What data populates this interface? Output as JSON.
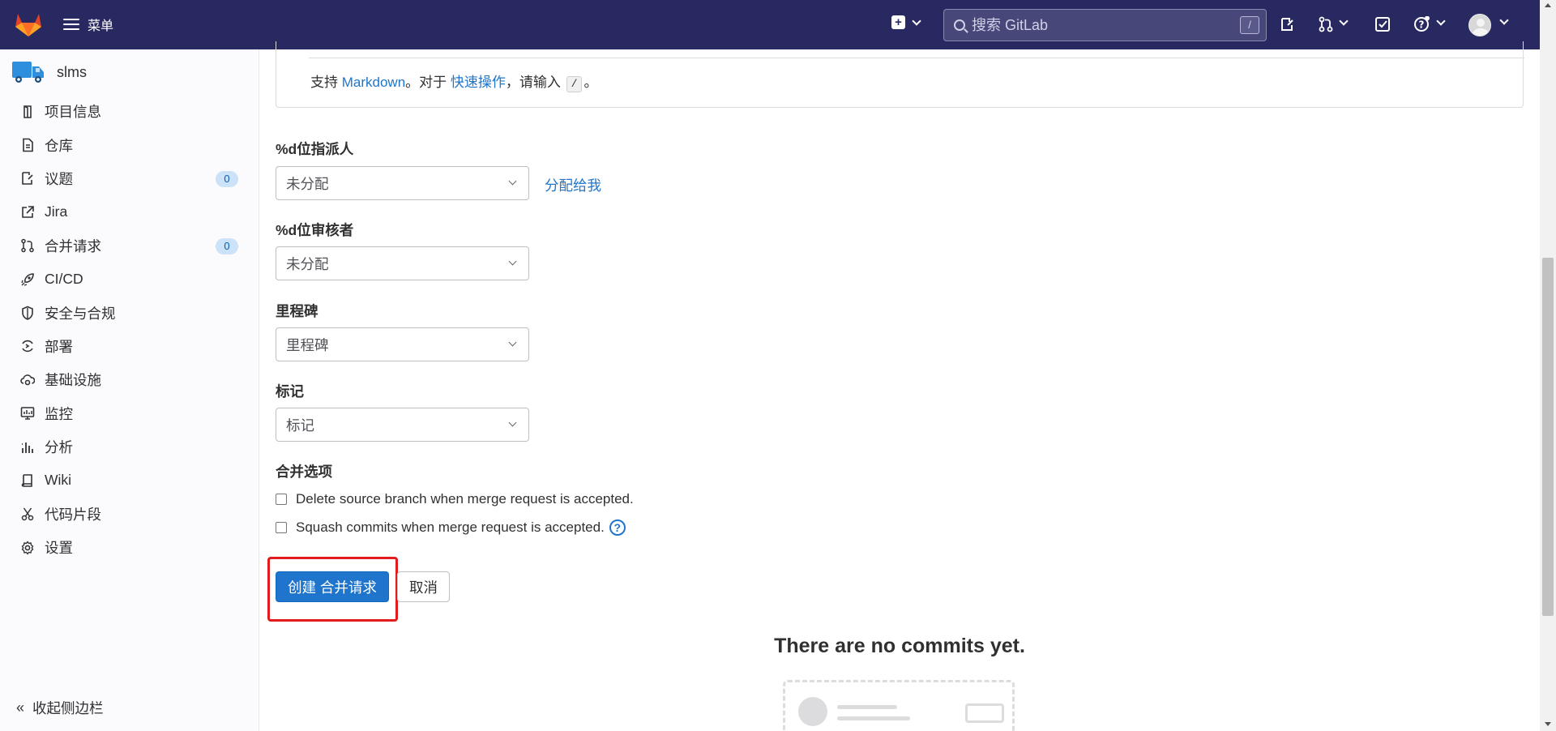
{
  "topnav": {
    "menu_label": "菜单",
    "search_placeholder": "搜索 GitLab",
    "search_shortcut": "/"
  },
  "sidebar": {
    "project_name": "slms",
    "items": [
      {
        "label": "项目信息",
        "icon": "info-icon"
      },
      {
        "label": "仓库",
        "icon": "document-icon"
      },
      {
        "label": "议题",
        "icon": "issues-icon",
        "badge": "0"
      },
      {
        "label": "Jira",
        "icon": "external-link-icon"
      },
      {
        "label": "合并请求",
        "icon": "merge-request-icon",
        "badge": "0"
      },
      {
        "label": "CI/CD",
        "icon": "rocket-icon"
      },
      {
        "label": "安全与合规",
        "icon": "shield-icon"
      },
      {
        "label": "部署",
        "icon": "deploy-icon"
      },
      {
        "label": "基础设施",
        "icon": "cloud-gear-icon"
      },
      {
        "label": "监控",
        "icon": "monitor-icon"
      },
      {
        "label": "分析",
        "icon": "chart-icon"
      },
      {
        "label": "Wiki",
        "icon": "book-icon"
      },
      {
        "label": "代码片段",
        "icon": "scissors-icon"
      },
      {
        "label": "设置",
        "icon": "gear-icon"
      }
    ],
    "collapse_label": "收起侧边栏"
  },
  "form": {
    "md_hint": {
      "prefix": "支持 ",
      "markdown_link": "Markdown",
      "middle": "。对于 ",
      "quick_actions_link": "快速操作",
      "suffix_before_key": "，请输入 ",
      "key": "/",
      "end": "。"
    },
    "assignee": {
      "label": "%d位指派人",
      "value": "未分配",
      "assign_me": "分配给我"
    },
    "reviewer": {
      "label": "%d位审核者",
      "value": "未分配"
    },
    "milestone": {
      "label": "里程碑",
      "value": "里程碑"
    },
    "labels": {
      "label": "标记",
      "value": "标记"
    },
    "merge_options": {
      "label": "合并选项",
      "delete_source": "Delete source branch when merge request is accepted.",
      "squash": "Squash commits when merge request is accepted."
    },
    "submit_label": "创建 合并请求",
    "cancel_label": "取消"
  },
  "empty_state": {
    "title": "There are no commits yet."
  },
  "colors": {
    "nav_bg": "#292961",
    "primary": "#1f75cb",
    "highlight": "#e21c1c"
  }
}
